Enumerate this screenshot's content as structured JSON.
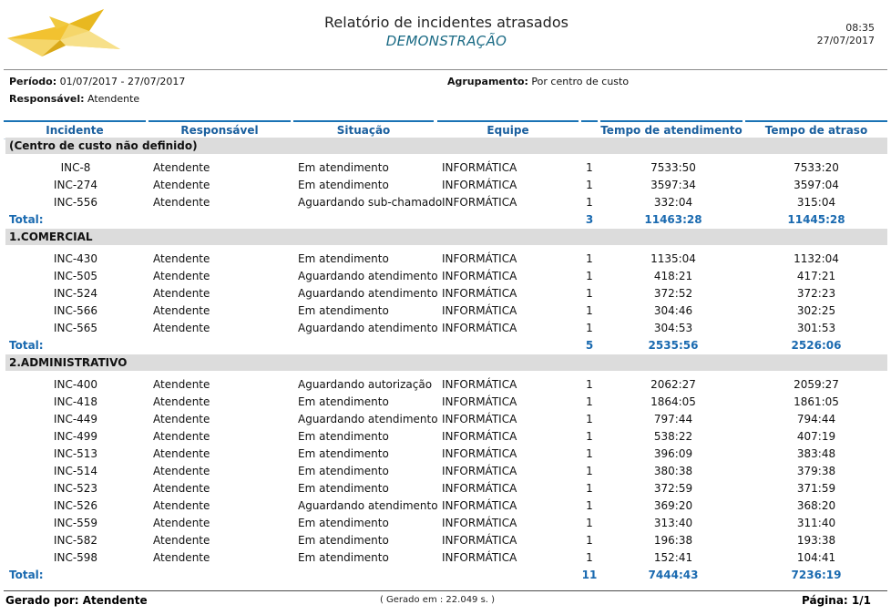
{
  "header": {
    "title": "Relatório de incidentes atrasados",
    "subtitle": "DEMONSTRAÇÃO",
    "time": "08:35",
    "date": "27/07/2017"
  },
  "meta": {
    "periodo_label": "Período:",
    "periodo_value": "01/07/2017 - 27/07/2017",
    "agrupamento_label": "Agrupamento:",
    "agrupamento_value": "Por centro de custo",
    "responsavel_label": "Responsável:",
    "responsavel_value": "Atendente"
  },
  "columns": {
    "incidente": "Incidente",
    "responsavel": "Responsável",
    "situacao": "Situação",
    "equipe": "Equipe",
    "qtd": "",
    "tempo_atendimento": "Tempo de atendimento",
    "tempo_atraso": "Tempo de atraso"
  },
  "groups": [
    {
      "name": "(Centro de custo não definido)",
      "rows": [
        {
          "incidente": "INC-8",
          "responsavel": "Atendente",
          "situacao": "Em atendimento",
          "equipe": "INFORMÁTICA",
          "qtd": "1",
          "tempo_atendimento": "7533:50",
          "tempo_atraso": "7533:20"
        },
        {
          "incidente": "INC-274",
          "responsavel": "Atendente",
          "situacao": "Em atendimento",
          "equipe": "INFORMÁTICA",
          "qtd": "1",
          "tempo_atendimento": "3597:34",
          "tempo_atraso": "3597:04"
        },
        {
          "incidente": "INC-556",
          "responsavel": "Atendente",
          "situacao": "Aguardando sub-chamado",
          "equipe": "INFORMÁTICA",
          "qtd": "1",
          "tempo_atendimento": "332:04",
          "tempo_atraso": "315:04"
        }
      ],
      "total": {
        "label": "Total:",
        "qtd": "3",
        "tempo_atendimento": "11463:28",
        "tempo_atraso": "11445:28"
      }
    },
    {
      "name": "1.COMERCIAL",
      "rows": [
        {
          "incidente": "INC-430",
          "responsavel": "Atendente",
          "situacao": "Em atendimento",
          "equipe": "INFORMÁTICA",
          "qtd": "1",
          "tempo_atendimento": "1135:04",
          "tempo_atraso": "1132:04"
        },
        {
          "incidente": "INC-505",
          "responsavel": "Atendente",
          "situacao": "Aguardando atendimento",
          "equipe": "INFORMÁTICA",
          "qtd": "1",
          "tempo_atendimento": "418:21",
          "tempo_atraso": "417:21"
        },
        {
          "incidente": "INC-524",
          "responsavel": "Atendente",
          "situacao": "Aguardando atendimento",
          "equipe": "INFORMÁTICA",
          "qtd": "1",
          "tempo_atendimento": "372:52",
          "tempo_atraso": "372:23"
        },
        {
          "incidente": "INC-566",
          "responsavel": "Atendente",
          "situacao": "Em atendimento",
          "equipe": "INFORMÁTICA",
          "qtd": "1",
          "tempo_atendimento": "304:46",
          "tempo_atraso": "302:25"
        },
        {
          "incidente": "INC-565",
          "responsavel": "Atendente",
          "situacao": "Aguardando atendimento",
          "equipe": "INFORMÁTICA",
          "qtd": "1",
          "tempo_atendimento": "304:53",
          "tempo_atraso": "301:53"
        }
      ],
      "total": {
        "label": "Total:",
        "qtd": "5",
        "tempo_atendimento": "2535:56",
        "tempo_atraso": "2526:06"
      }
    },
    {
      "name": "2.ADMINISTRATIVO",
      "rows": [
        {
          "incidente": "INC-400",
          "responsavel": "Atendente",
          "situacao": "Aguardando autorização",
          "equipe": "INFORMÁTICA",
          "qtd": "1",
          "tempo_atendimento": "2062:27",
          "tempo_atraso": "2059:27"
        },
        {
          "incidente": "INC-418",
          "responsavel": "Atendente",
          "situacao": "Em atendimento",
          "equipe": "INFORMÁTICA",
          "qtd": "1",
          "tempo_atendimento": "1864:05",
          "tempo_atraso": "1861:05"
        },
        {
          "incidente": "INC-449",
          "responsavel": "Atendente",
          "situacao": "Aguardando atendimento",
          "equipe": "INFORMÁTICA",
          "qtd": "1",
          "tempo_atendimento": "797:44",
          "tempo_atraso": "794:44"
        },
        {
          "incidente": "INC-499",
          "responsavel": "Atendente",
          "situacao": "Em atendimento",
          "equipe": "INFORMÁTICA",
          "qtd": "1",
          "tempo_atendimento": "538:22",
          "tempo_atraso": "407:19"
        },
        {
          "incidente": "INC-513",
          "responsavel": "Atendente",
          "situacao": "Em atendimento",
          "equipe": "INFORMÁTICA",
          "qtd": "1",
          "tempo_atendimento": "396:09",
          "tempo_atraso": "383:48"
        },
        {
          "incidente": "INC-514",
          "responsavel": "Atendente",
          "situacao": "Em atendimento",
          "equipe": "INFORMÁTICA",
          "qtd": "1",
          "tempo_atendimento": "380:38",
          "tempo_atraso": "379:38"
        },
        {
          "incidente": "INC-523",
          "responsavel": "Atendente",
          "situacao": "Em atendimento",
          "equipe": "INFORMÁTICA",
          "qtd": "1",
          "tempo_atendimento": "372:59",
          "tempo_atraso": "371:59"
        },
        {
          "incidente": "INC-526",
          "responsavel": "Atendente",
          "situacao": "Aguardando atendimento",
          "equipe": "INFORMÁTICA",
          "qtd": "1",
          "tempo_atendimento": "369:20",
          "tempo_atraso": "368:20"
        },
        {
          "incidente": "INC-559",
          "responsavel": "Atendente",
          "situacao": "Em atendimento",
          "equipe": "INFORMÁTICA",
          "qtd": "1",
          "tempo_atendimento": "313:40",
          "tempo_atraso": "311:40"
        },
        {
          "incidente": "INC-582",
          "responsavel": "Atendente",
          "situacao": "Em atendimento",
          "equipe": "INFORMÁTICA",
          "qtd": "1",
          "tempo_atendimento": "196:38",
          "tempo_atraso": "193:38"
        },
        {
          "incidente": "INC-598",
          "responsavel": "Atendente",
          "situacao": "Em atendimento",
          "equipe": "INFORMÁTICA",
          "qtd": "1",
          "tempo_atendimento": "152:41",
          "tempo_atraso": "104:41"
        }
      ],
      "total": {
        "label": "Total:",
        "qtd": "11",
        "tempo_atendimento": "7444:43",
        "tempo_atraso": "7236:19"
      }
    }
  ],
  "footer": {
    "gerado_por": "Gerado por: Atendente",
    "gerado_em": "( Gerado em : 22.049 s. )",
    "pagina": "Página: 1/1"
  },
  "colors": {
    "accent": "#1a6ab0",
    "header_border": "#1a73b5",
    "group_band": "#dcdcdc",
    "subtitle": "#1a6a84",
    "logo": "#f2c230"
  },
  "icons": {
    "logo": "origami-airplane-logo"
  }
}
